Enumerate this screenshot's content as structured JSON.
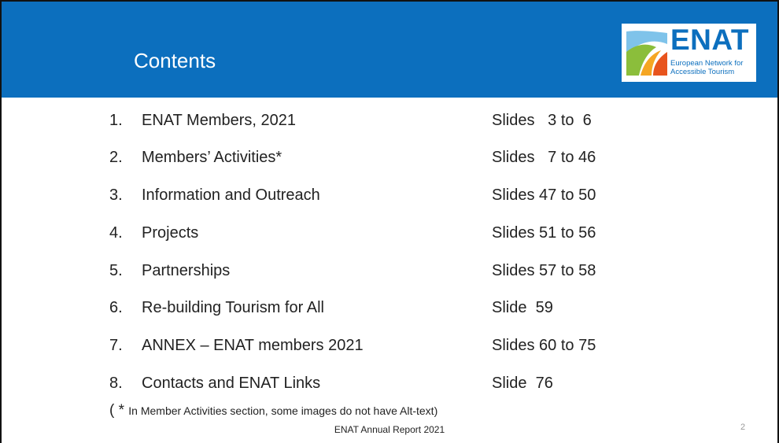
{
  "header": {
    "title": "Contents",
    "bg_color": "#0c6fbe"
  },
  "logo": {
    "word": "ENAT",
    "line1": "European Network for",
    "line2": "Accessible Tourism"
  },
  "items": [
    {
      "num": "1.",
      "label": "ENAT Members, 2021",
      "slides": "Slides   3 to  6"
    },
    {
      "num": "2.",
      "label": "Members’ Activities*",
      "slides": "Slides   7 to 46"
    },
    {
      "num": "3.",
      "label": "Information and Outreach",
      "slides": "Slides 47 to 50"
    },
    {
      "num": "4.",
      "label": "Projects",
      "slides": "Slides 51 to 56"
    },
    {
      "num": "5.",
      "label": "Partnerships",
      "slides": "Slides 57 to 58"
    },
    {
      "num": "6.",
      "label": "Re-building Tourism for All",
      "slides": "Slide  59"
    },
    {
      "num": "7.",
      "label": "ANNEX – ENAT members 2021",
      "slides": "Slides 60 to 75"
    },
    {
      "num": "8.",
      "label": "Contacts and ENAT Links",
      "slides": "Slide  76"
    }
  ],
  "note": {
    "prefix": "( * ",
    "text": "In Member Activities section, some images do not have Alt-text)"
  },
  "footer": "ENAT Annual Report 2021",
  "page_number": "2"
}
